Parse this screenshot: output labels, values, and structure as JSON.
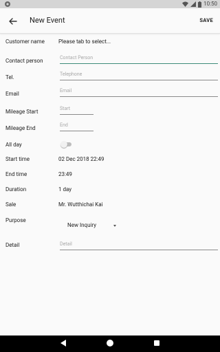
{
  "status_bar": {
    "time": "10:50"
  },
  "app_bar": {
    "title": "New Event",
    "save_label": "SAVE"
  },
  "form": {
    "customer_name": {
      "label": "Customer name",
      "value": "Please tab to select..."
    },
    "contact_person": {
      "label": "Contact person",
      "placeholder": "Contact Person"
    },
    "tel": {
      "label": "Tel.",
      "placeholder": "Telephone"
    },
    "email": {
      "label": "Email",
      "placeholder": "Email"
    },
    "mileage_start": {
      "label": "Mileage Start",
      "placeholder": "Start"
    },
    "mileage_end": {
      "label": "Mileage End",
      "placeholder": "End"
    },
    "all_day": {
      "label": "All day",
      "checked": false
    },
    "start_time": {
      "label": "Start time",
      "value": "02 Dec 2018 22:49"
    },
    "end_time": {
      "label": "End time",
      "value": "23:49"
    },
    "duration": {
      "label": "Duration",
      "value": "1 day"
    },
    "sale": {
      "label": "Sale",
      "value": "Mr. Wutthichai Kai"
    },
    "purpose": {
      "label": "Purpose",
      "selected": "New Inquiry"
    },
    "detail": {
      "label": "Detail",
      "placeholder": "Detail"
    }
  },
  "colors": {
    "accent": "#3c8b7a",
    "status_bar": "#d5d5d5",
    "nav_bar": "#000000"
  }
}
